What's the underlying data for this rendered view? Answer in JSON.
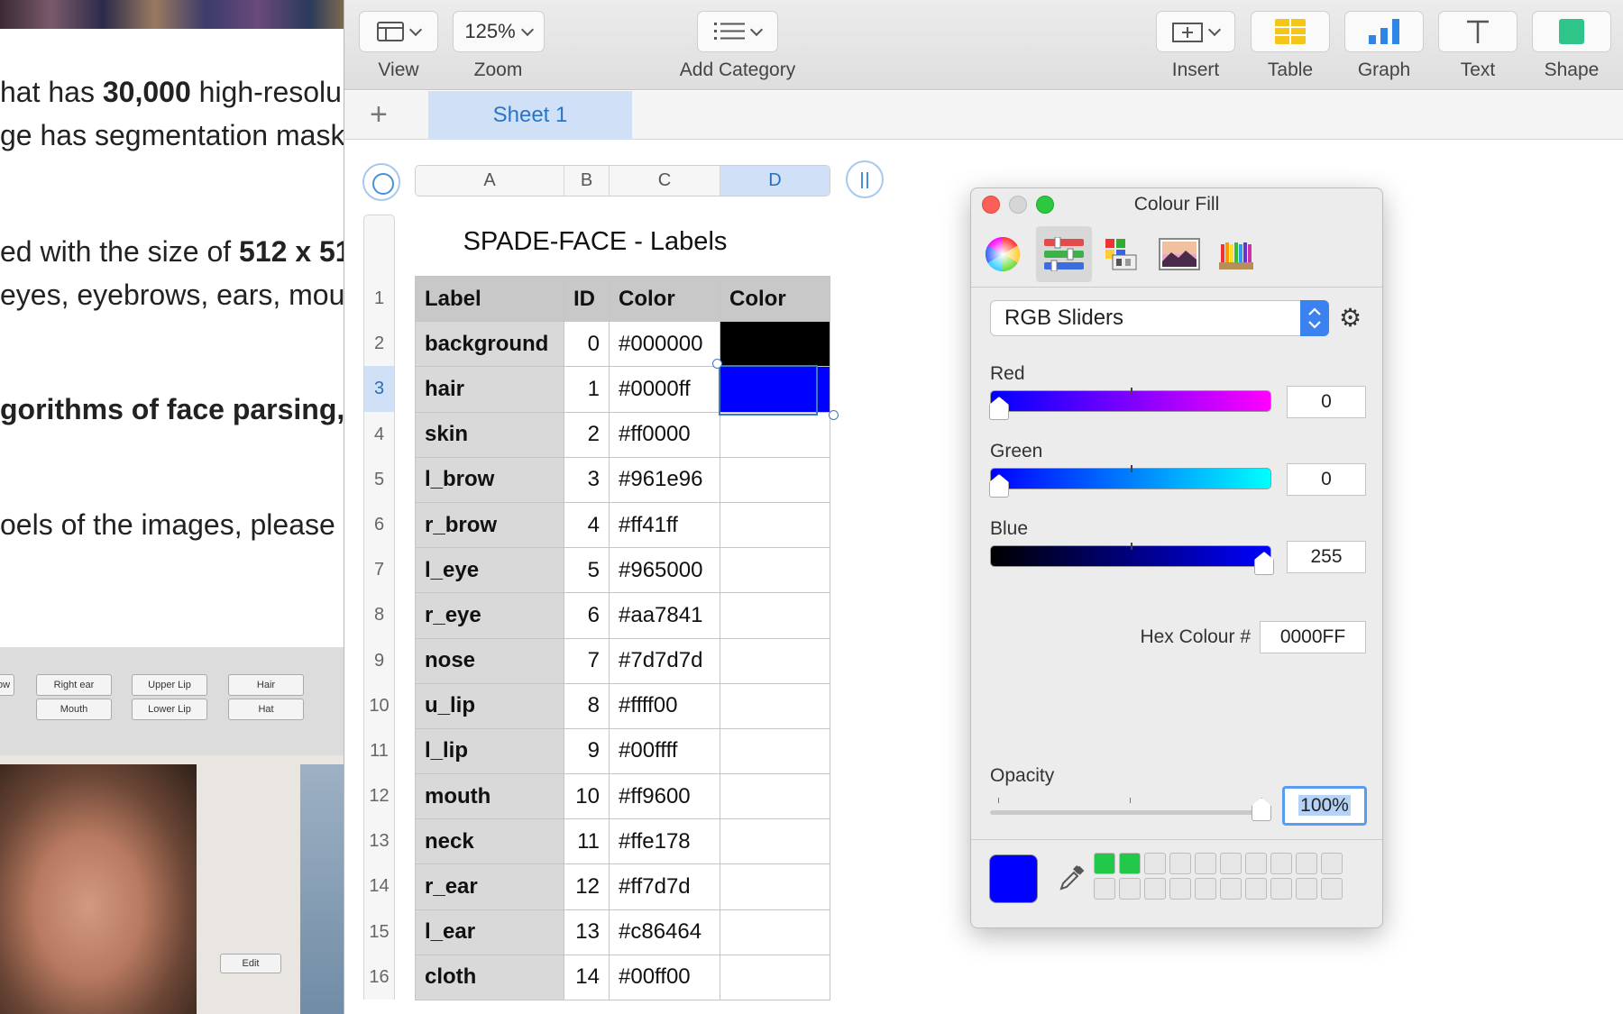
{
  "web_page": {
    "lines": [
      {
        "pre": "hat has ",
        "bold": "30,000",
        "post": " high-resolu"
      },
      {
        "pre": "ge has segmentation mask",
        "bold": "",
        "post": ""
      },
      {
        "pre": "ed with the size of ",
        "bold": "512 x 51",
        "post": ""
      },
      {
        "pre": " eyes, eyebrows, ears, mou",
        "bold": "",
        "post": ""
      },
      {
        "pre": "",
        "bold": "gorithms of face parsing, f",
        "post": ""
      },
      {
        "pre": "oels of the images, please s",
        "bold": "",
        "post": ""
      }
    ],
    "screenshot_buttons": [
      "ow",
      "Right ear",
      "Upper Lip",
      "Hair",
      "Mouth",
      "Lower Lip",
      "Hat"
    ],
    "edit_button": "Edit"
  },
  "toolbar": {
    "view_label": "View",
    "zoom_value": "125%",
    "zoom_label": "Zoom",
    "add_category_label": "Add Category",
    "insert_label": "Insert",
    "table_label": "Table",
    "graph_label": "Graph",
    "text_label": "Text",
    "shape_label": "Shape"
  },
  "sheets": {
    "add_symbol": "+",
    "tabs": [
      {
        "label": "Sheet 1",
        "active": true
      }
    ]
  },
  "columns": [
    "A",
    "B",
    "C",
    "D"
  ],
  "active_column": "D",
  "rows": [
    "1",
    "2",
    "3",
    "4",
    "5",
    "6",
    "7",
    "8",
    "9",
    "10",
    "11",
    "12",
    "13",
    "14",
    "15",
    "16"
  ],
  "active_row": "3",
  "table": {
    "title": "SPADE-FACE - Labels",
    "headers": [
      "Label",
      "ID",
      "Color",
      "Color"
    ],
    "rows": [
      {
        "label": "background",
        "id": "0",
        "color": "#000000",
        "fill": "#000000"
      },
      {
        "label": "hair",
        "id": "1",
        "color": "#0000ff",
        "fill": "#0000ff"
      },
      {
        "label": "skin",
        "id": "2",
        "color": "#ff0000",
        "fill": ""
      },
      {
        "label": "l_brow",
        "id": "3",
        "color": "#961e96",
        "fill": ""
      },
      {
        "label": "r_brow",
        "id": "4",
        "color": "#ff41ff",
        "fill": ""
      },
      {
        "label": "l_eye",
        "id": "5",
        "color": "#965000",
        "fill": ""
      },
      {
        "label": "r_eye",
        "id": "6",
        "color": "#aa7841",
        "fill": ""
      },
      {
        "label": "nose",
        "id": "7",
        "color": "#7d7d7d",
        "fill": ""
      },
      {
        "label": "u_lip",
        "id": "8",
        "color": "#ffff00",
        "fill": ""
      },
      {
        "label": "l_lip",
        "id": "9",
        "color": "#00ffff",
        "fill": ""
      },
      {
        "label": "mouth",
        "id": "10",
        "color": "#ff9600",
        "fill": ""
      },
      {
        "label": "neck",
        "id": "11",
        "color": "#ffe178",
        "fill": ""
      },
      {
        "label": "r_ear",
        "id": "12",
        "color": "#ff7d7d",
        "fill": ""
      },
      {
        "label": "l_ear",
        "id": "13",
        "color": "#c86464",
        "fill": ""
      },
      {
        "label": "cloth",
        "id": "14",
        "color": "#00ff00",
        "fill": ""
      }
    ]
  },
  "colour_panel": {
    "title": "Colour Fill",
    "mode": "RGB Sliders",
    "red_label": "Red",
    "red_value": "0",
    "green_label": "Green",
    "green_value": "0",
    "blue_label": "Blue",
    "blue_value": "255",
    "hex_label": "Hex Colour #",
    "hex_value": "0000FF",
    "opacity_label": "Opacity",
    "opacity_value": "100%",
    "current_colour": "#0000ff",
    "saved_swatches": [
      "#22c84a",
      "#22c84a"
    ]
  }
}
